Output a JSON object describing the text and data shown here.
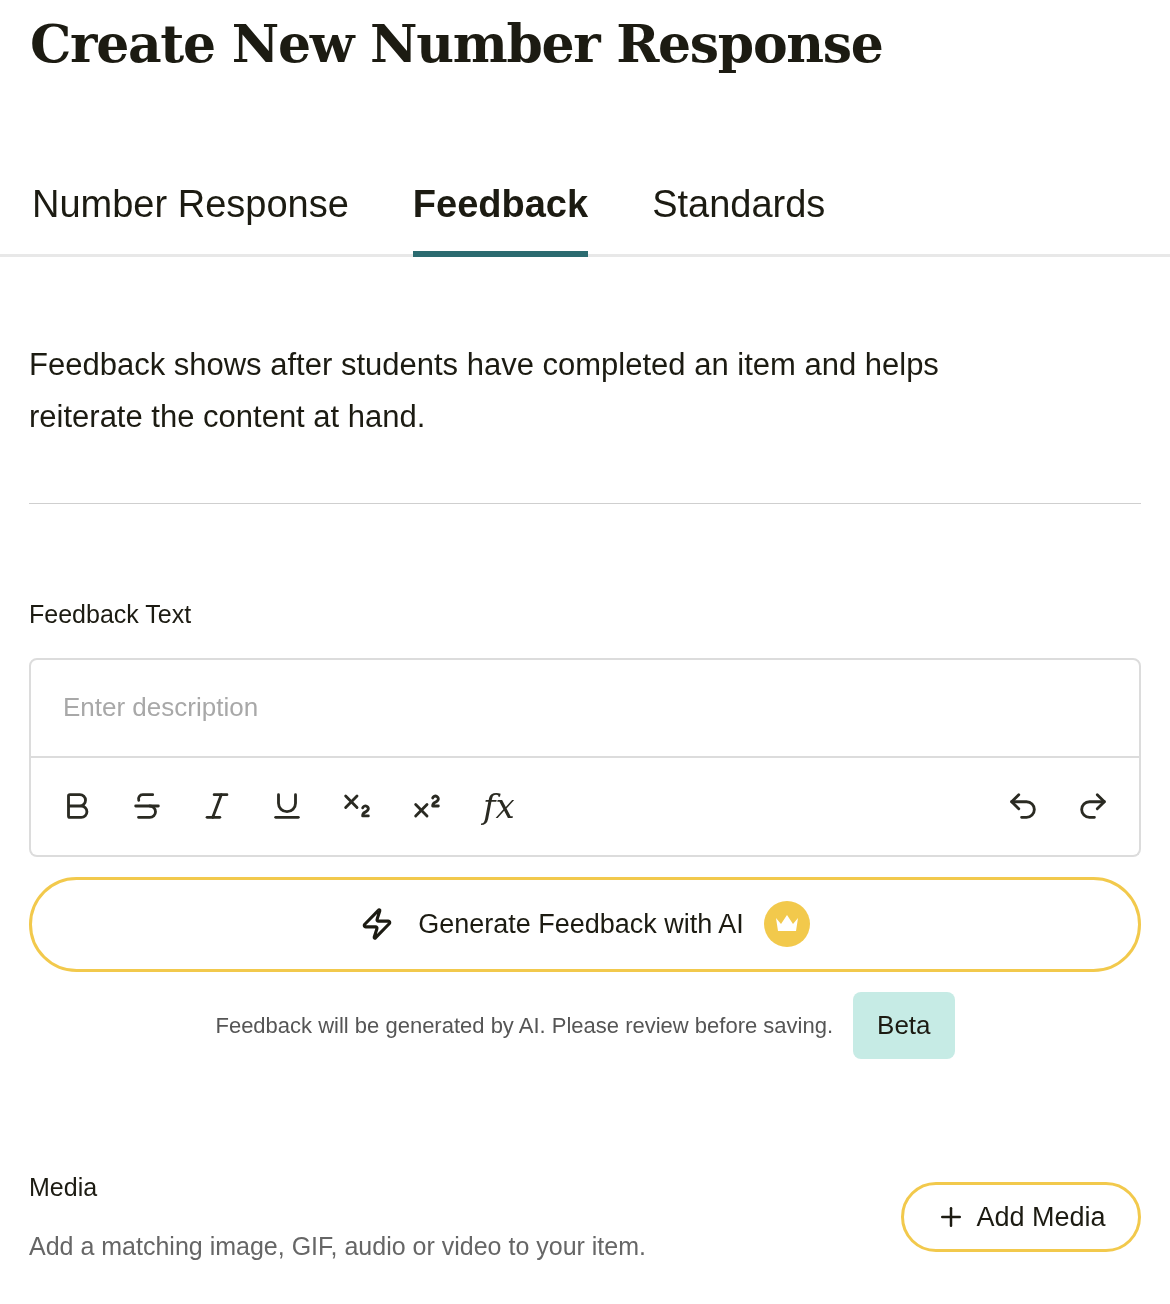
{
  "title": "Create New Number Response",
  "tabs": [
    {
      "label": "Number Response",
      "selected": false
    },
    {
      "label": "Feedback",
      "selected": true
    },
    {
      "label": "Standards",
      "selected": false
    }
  ],
  "description": "Feedback shows after students have completed an item and helps reiterate the content at hand.",
  "feedback_field": {
    "label": "Feedback Text",
    "placeholder": "Enter description",
    "clear_format": "fx"
  },
  "ai_button": {
    "label": "Generate Feedback with AI"
  },
  "ai_note": {
    "text": "Feedback will be generated by AI. Please review before saving.",
    "badge": "Beta"
  },
  "media": {
    "label": "Media",
    "hint": "Add a matching image, GIF, audio or video to your item.",
    "button": "Add Media"
  }
}
